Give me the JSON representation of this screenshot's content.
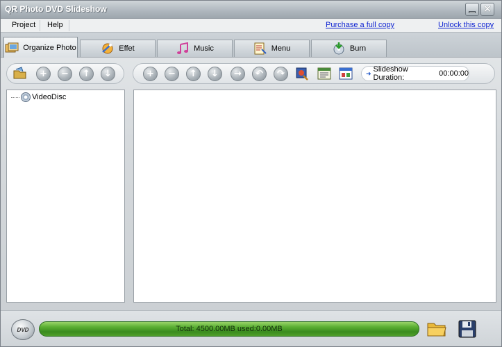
{
  "window": {
    "title": "QR Photo DVD Slideshow"
  },
  "menu": {
    "items": [
      "Project",
      "Help"
    ],
    "links": {
      "purchase": "Purchase a full copy",
      "unlock": "Unlock this copy"
    }
  },
  "tabs": [
    {
      "label": "Organize Photo",
      "icon": "photos-icon",
      "active": true
    },
    {
      "label": "Effet",
      "icon": "effect-icon",
      "active": false
    },
    {
      "label": "Music",
      "icon": "music-icon",
      "active": false
    },
    {
      "label": "Menu",
      "icon": "menu-icon",
      "active": false
    },
    {
      "label": "Burn",
      "icon": "burn-icon",
      "active": false
    }
  ],
  "duration": {
    "label": "Slideshow Duration:",
    "value": "00:00:00"
  },
  "tree": {
    "root": "VideoDisc"
  },
  "capacity": {
    "text": "Total: 4500.00MB used:0.00MB",
    "used_fraction": 0.0
  },
  "bottom": {
    "dvd_label": "DVD"
  },
  "colors": {
    "capacity_bar": "#4fa32c",
    "link": "#0a1fd1"
  }
}
